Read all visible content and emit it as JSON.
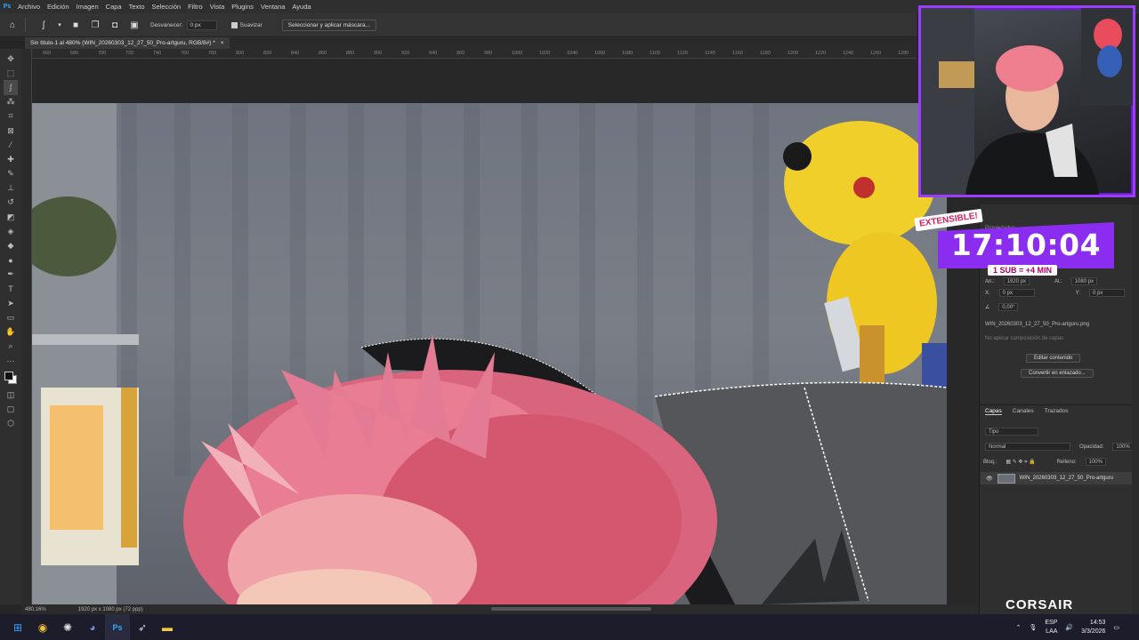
{
  "menubar": {
    "logo": "Ps",
    "items": [
      "Archivo",
      "Edición",
      "Imagen",
      "Capa",
      "Texto",
      "Selección",
      "Filtro",
      "Vista",
      "Plugins",
      "Ventana",
      "Ayuda"
    ]
  },
  "options": {
    "feather_label": "Desvanecer:",
    "feather_value": "0 px",
    "antialias_label": "Suavizar",
    "select_mask_label": "Seleccionar y aplicar máscara..."
  },
  "document": {
    "tab_title": "Sin título-1 al 480% (WIN_20260303_12_27_50_Pro-artguru, RGB/8#) *",
    "close": "×"
  },
  "ruler": {
    "ticks": [
      "660",
      "680",
      "700",
      "720",
      "740",
      "760",
      "780",
      "800",
      "820",
      "840",
      "860",
      "880",
      "900",
      "920",
      "940",
      "960",
      "980",
      "1000",
      "1020",
      "1040",
      "1060",
      "1080",
      "1100",
      "1120",
      "1140",
      "1160",
      "1180",
      "1200",
      "1220",
      "1240",
      "1260",
      "1280"
    ]
  },
  "status": {
    "zoom": "480.16%",
    "doc_size": "1920 px x 1080 px (72 ppp)"
  },
  "properties": {
    "tab_label": "Propiedades",
    "w_label": "An.:",
    "w_value": "1920 px",
    "h_label": "Al.:",
    "h_value": "1080 px",
    "x_label": "X:",
    "x_value": "0 px",
    "y_label": "Y:",
    "y_value": "0 px",
    "angle_value": "0,00°",
    "filename": "WIN_20260303_12_27_50_Pro-artguru.png",
    "comp_placeholder": "No aplicar composición de capas",
    "edit_contents": "Editar contenido",
    "convert_linked": "Convertir en enlazado..."
  },
  "layers": {
    "tabs": [
      "Capas",
      "Canales",
      "Trazados"
    ],
    "filter_label": "Tipo",
    "blend_mode": "Normal",
    "opacity_label": "Opacidad:",
    "opacity_value": "100%",
    "lock_label": "Bloq.:",
    "fill_label": "Relleno:",
    "fill_value": "100%",
    "layer_name": "WIN_20260303_12_27_50_Pro-artguru"
  },
  "overlay": {
    "extensible": "EXTENSIBLE!",
    "timer": "17:10:04",
    "sub_rate": "1 SUB = +4 MIN",
    "brand": "CORSAIR"
  },
  "taskbar": {
    "lang_top": "ESP",
    "lang_bottom": "LAA",
    "time": "14:53",
    "date": "3/3/2026"
  },
  "colors": {
    "accent_purple": "#9b3dff",
    "ps_blue": "#31a8ff",
    "hair_pink": "#e8708f"
  }
}
